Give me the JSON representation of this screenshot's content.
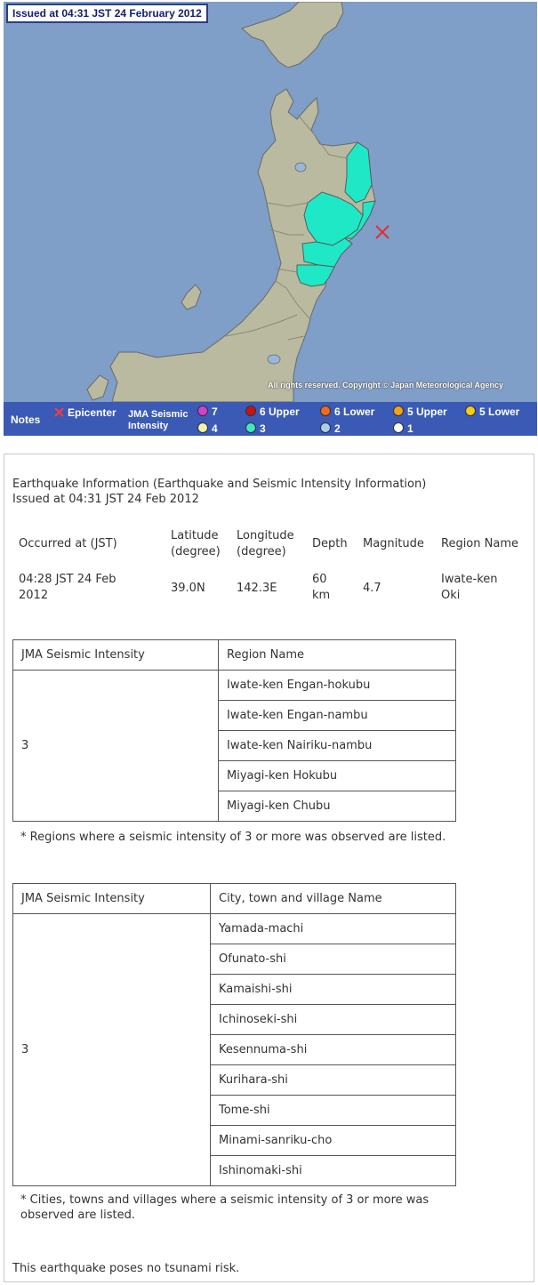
{
  "map": {
    "issued_banner": "Issued at 04:31 JST  24 February 2012",
    "copyright": "All rights reserved. Copyright © Japan Meteorological Agency",
    "colors": {
      "sea": "#7f9ec8",
      "land": "#b9ba9f",
      "highlight": "#1fe8c6",
      "boundary": "#707070",
      "epicenter": "#e03030",
      "legend_bg": "#3b5ab6"
    },
    "epicenter_icon": "x-mark-icon"
  },
  "legend": {
    "notes": "Notes",
    "epicenter": "Epicenter",
    "jma_line1": "JMA Seismic",
    "jma_line2": "Intensity",
    "levels": [
      {
        "label": "7",
        "color": "#d340d3"
      },
      {
        "label": "6 Upper",
        "color": "#cc1111"
      },
      {
        "label": "6 Lower",
        "color": "#f26a1a"
      },
      {
        "label": "5 Upper",
        "color": "#f4a21c"
      },
      {
        "label": "5 Lower",
        "color": "#f4cc1a"
      },
      {
        "label": "4",
        "color": "#f3f0b0"
      },
      {
        "label": "3",
        "color": "#3de8c4"
      },
      {
        "label": "2",
        "color": "#a8cdf0"
      },
      {
        "label": "1",
        "color": "#ffffff"
      }
    ]
  },
  "info": {
    "heading": "Earthquake Information (Earthquake and Seismic Intensity Information)",
    "issued": "Issued at 04:31 JST 24 Feb 2012",
    "summary_headers": {
      "occurred": "Occurred at (JST)",
      "lat1": "Latitude",
      "lat2": "(degree)",
      "lon1": "Longitude",
      "lon2": "(degree)",
      "depth": "Depth",
      "magnitude": "Magnitude",
      "region": "Region Name"
    },
    "summary_values": {
      "occurred1": "04:28 JST 24 Feb",
      "occurred2": "2012",
      "lat": "39.0N",
      "lon": "142.3E",
      "depth1": "60",
      "depth2": "km",
      "magnitude": "4.7",
      "region1": "Iwate-ken",
      "region2": "Oki"
    },
    "region_table": {
      "col1": "JMA Seismic Intensity",
      "col2": "Region Name",
      "intensity": "3",
      "rows": [
        "Iwate-ken Engan-hokubu",
        "Iwate-ken Engan-nambu",
        "Iwate-ken Nairiku-nambu",
        "Miyagi-ken Hokubu",
        "Miyagi-ken Chubu"
      ]
    },
    "region_note": "* Regions where a seismic intensity of 3 or more was observed are listed.",
    "city_table": {
      "col1": "JMA Seismic Intensity",
      "col2": "City, town and village Name",
      "intensity": "3",
      "rows": [
        "Yamada-machi",
        "Ofunato-shi",
        "Kamaishi-shi",
        "Ichinoseki-shi",
        "Kesennuma-shi",
        "Kurihara-shi",
        "Tome-shi",
        "Minami-sanriku-cho",
        "Ishinomaki-shi"
      ]
    },
    "city_note1": "* Cities, towns and villages where a seismic intensity of 3 or more was",
    "city_note2": "observed are listed.",
    "tsunami": "This earthquake poses no tsunami risk."
  }
}
